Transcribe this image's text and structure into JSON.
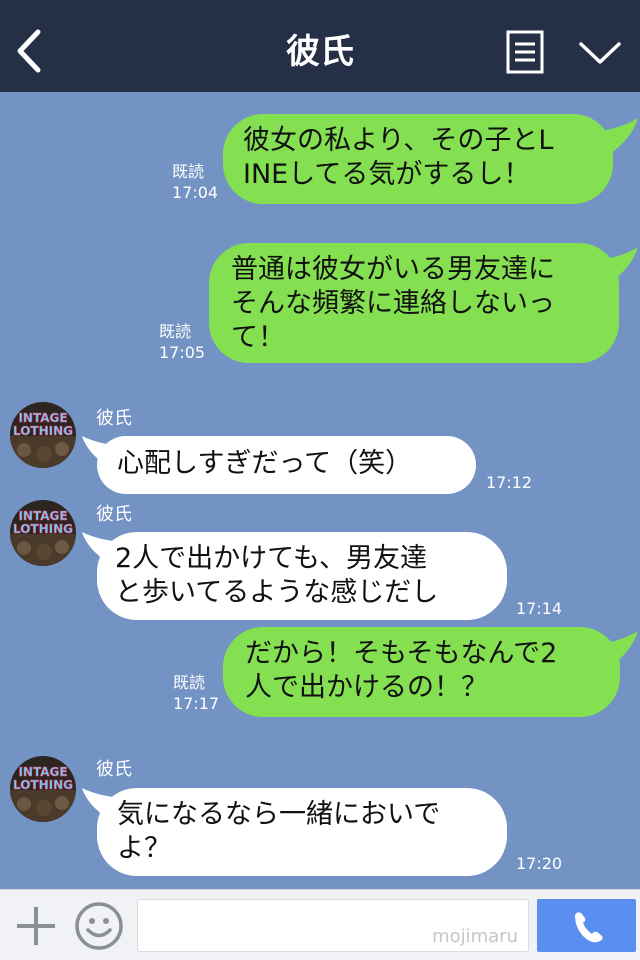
{
  "header": {
    "title": "彼氏"
  },
  "messages": [
    {
      "dir": "out",
      "lines": [
        "彼女の私より、その子とL",
        "INEしてる気がするし！"
      ],
      "read": "既読",
      "time": "17:04"
    },
    {
      "dir": "out",
      "lines": [
        "普通は彼女がいる男友達に",
        "そんな頻繁に連絡しないっ",
        "て！"
      ],
      "read": "既読",
      "time": "17:05"
    },
    {
      "dir": "in",
      "sender": "彼氏",
      "lines": [
        "心配しすぎだって（笑）"
      ],
      "time": "17:12"
    },
    {
      "dir": "in",
      "sender": "彼氏",
      "lines": [
        "2人で出かけても、男友達",
        "と歩いてるような感じだし"
      ],
      "time": "17:14"
    },
    {
      "dir": "out",
      "lines": [
        "だから！そもそもなんで2",
        "人で出かけるの！？"
      ],
      "read": "既読",
      "time": "17:17"
    },
    {
      "dir": "in",
      "sender": "彼氏",
      "lines": [
        "気になるなら一緒においで",
        "よ？"
      ],
      "time": "17:20"
    }
  ],
  "avatar": {
    "lines": [
      "INTAGE",
      "LOTHING"
    ]
  },
  "footer": {
    "watermark": "mojimaru"
  },
  "colors": {
    "header": "#253046",
    "chat_bg": "#7293c3",
    "outgoing": "#84e051",
    "incoming": "#ffffff",
    "call": "#5a8ef1"
  }
}
